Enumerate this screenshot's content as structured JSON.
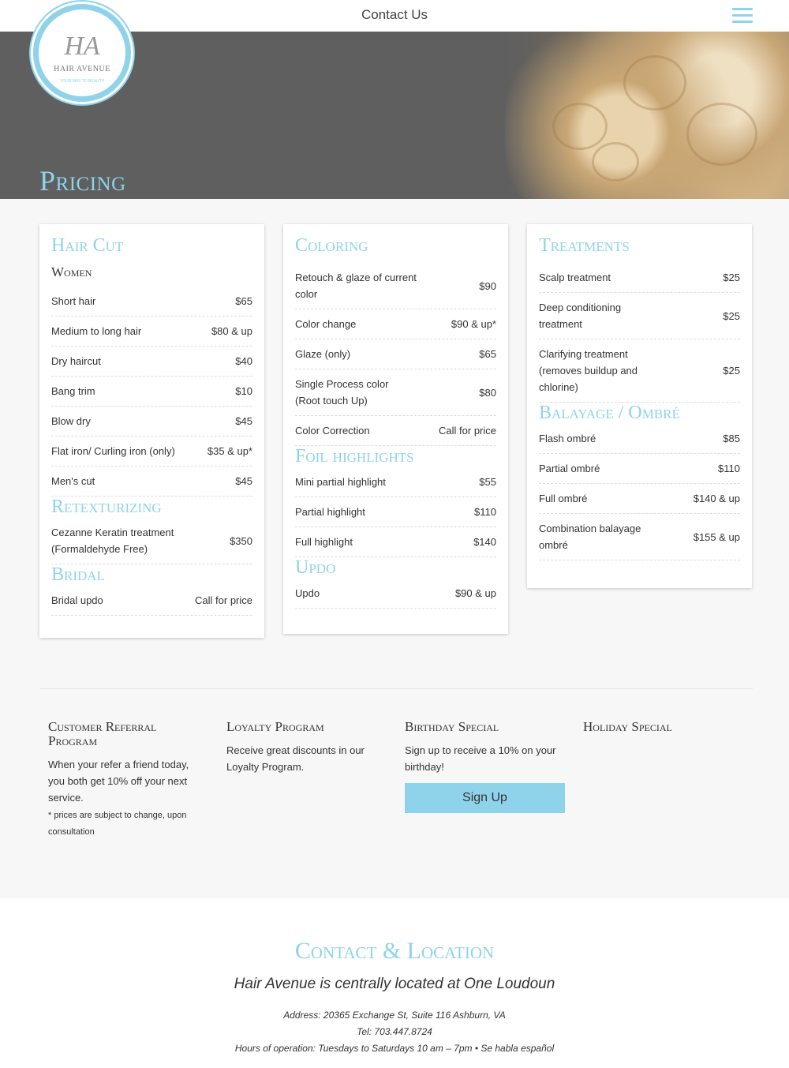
{
  "nav": {
    "title": "Contact Us",
    "menu_icon": "hamburger-icon"
  },
  "logo": {
    "monogram": "HA",
    "name": "HAIR AVENUE",
    "tagline": "YOUR WAY TO BEAUTY"
  },
  "hero": {
    "title": "Pricing"
  },
  "colors": {
    "accent": "#8fd3ea",
    "text": "#333333",
    "hero_bg": "#5f5f5f"
  },
  "haircut": {
    "title": "Hair Cut",
    "subtitle": "Women",
    "items": [
      {
        "service": "Short hair",
        "price": "$65"
      },
      {
        "service": "Medium to long hair",
        "price": "$80 & up"
      },
      {
        "service": "Dry haircut",
        "price": "$40"
      },
      {
        "service": "Bang trim",
        "price": "$10"
      },
      {
        "service": "Blow dry",
        "price": "$45"
      },
      {
        "service": "Flat iron/ Curling iron (only)",
        "price": "$35 & up*"
      },
      {
        "service": "Men's cut",
        "price": "$45"
      }
    ]
  },
  "retexturizing": {
    "title": "Retexturizing",
    "items": [
      {
        "service": "Cezanne Keratin treatment (Formaldehyde Free)",
        "price": "$350"
      }
    ]
  },
  "bridal": {
    "title": "Bridal",
    "items": [
      {
        "service": "Bridal updo",
        "price": "Call for price"
      }
    ]
  },
  "coloring": {
    "title": "Coloring",
    "items": [
      {
        "service": "Retouch & glaze of current color",
        "price": "$90"
      },
      {
        "service": "Color change",
        "price": "$90 & up*"
      },
      {
        "service": "Glaze (only)",
        "price": "$65"
      },
      {
        "service": "Single Process color (Root touch Up)",
        "price": "$80"
      },
      {
        "service": "Color Correction",
        "price": "Call for price"
      }
    ]
  },
  "foil": {
    "title": "Foil highlights",
    "items": [
      {
        "service": "Mini partial highlight",
        "price": "$55"
      },
      {
        "service": "Partial highlight",
        "price": "$110"
      },
      {
        "service": "Full highlight",
        "price": "$140"
      }
    ]
  },
  "updo": {
    "title": "Updo",
    "items": [
      {
        "service": "Updo",
        "price": "$90 & up"
      }
    ]
  },
  "treatments": {
    "title": "Treatments",
    "items": [
      {
        "service": "Scalp treatment",
        "price": "$25"
      },
      {
        "service": "Deep conditioning treatment",
        "price": "$25"
      },
      {
        "service": "Clarifying treatment (removes buildup and chlorine)",
        "price": "$25"
      }
    ]
  },
  "balayage": {
    "title": "Balayage / Ombré",
    "items": [
      {
        "service": "Flash ombré",
        "price": "$85"
      },
      {
        "service": "Partial ombré",
        "price": "$110"
      },
      {
        "service": "Full ombré",
        "price": "$140 & up"
      },
      {
        "service": "Combination balayage ombré",
        "price": "$155 & up"
      }
    ]
  },
  "promos": {
    "referral": {
      "title": "Customer Referral Program",
      "text": "When your refer a friend today, you both get 10% off your next service.",
      "note": "* prices are subject to change, upon consultation"
    },
    "loyalty": {
      "title": "Loyalty Program",
      "text": "Receive great discounts in our Loyalty Program."
    },
    "birthday": {
      "title": "Birthday Special",
      "text": "Sign up to receive a 10% on your birthday!",
      "button": "Sign Up"
    },
    "holiday": {
      "title": "Holiday Special"
    }
  },
  "contact": {
    "title": "Contact & Location",
    "tagline": "Hair Avenue is centrally located at One Loudoun",
    "address": "Address: 20365 Exchange St, Suite 116 Ashburn, VA",
    "tel": "Tel: 703.447.8724",
    "hours": "Hours of operation: Tuesdays to Saturdays 10 am – 7pm • Se habla español"
  }
}
